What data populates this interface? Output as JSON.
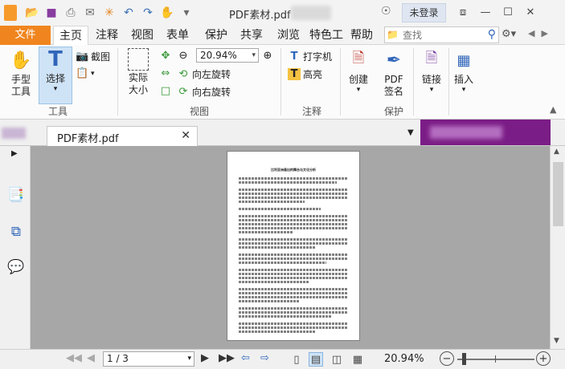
{
  "titlebar": {
    "title": "PDF素材.pdf -",
    "login_label": "未登录",
    "qat_icons": [
      "folder-open-icon",
      "save-icon",
      "print-icon",
      "email-icon",
      "new-star-icon",
      "undo-icon",
      "redo-icon",
      "hand-icon",
      "customize-dropdown-icon"
    ]
  },
  "tabs": {
    "file": "文件",
    "items": [
      "主页",
      "注释",
      "视图",
      "表单",
      "保护",
      "共享",
      "浏览",
      "特色工",
      "帮助"
    ],
    "search_placeholder": "查找"
  },
  "ribbon": {
    "hand_tool": "手型\n工具",
    "select_tool": "选择",
    "screenshot": "截图",
    "tools_group": "工具",
    "actual_size": "实际\n大小",
    "zoom_value": "20.94%",
    "rotate_left": "向左旋转",
    "rotate_right": "向右旋转",
    "view_group": "视图",
    "typewriter": "打字机",
    "highlight": "高亮",
    "annot_group": "注释",
    "create": "创建",
    "pdf_sign": "PDF\n签名",
    "protect_group": "保护",
    "link": "链接",
    "insert": "插入"
  },
  "doc": {
    "tab_name": "PDF素材.pdf",
    "page_title": "比利亚洲画出的舞台与文化分析"
  },
  "statusbar": {
    "page_display": "1 / 3",
    "zoom": "20.94%"
  },
  "colors": {
    "file_tab": "#f0851f",
    "banner": "#7b1d86",
    "selected_tool": "#cfe3f6",
    "doc_background": "#a7a7a7"
  }
}
